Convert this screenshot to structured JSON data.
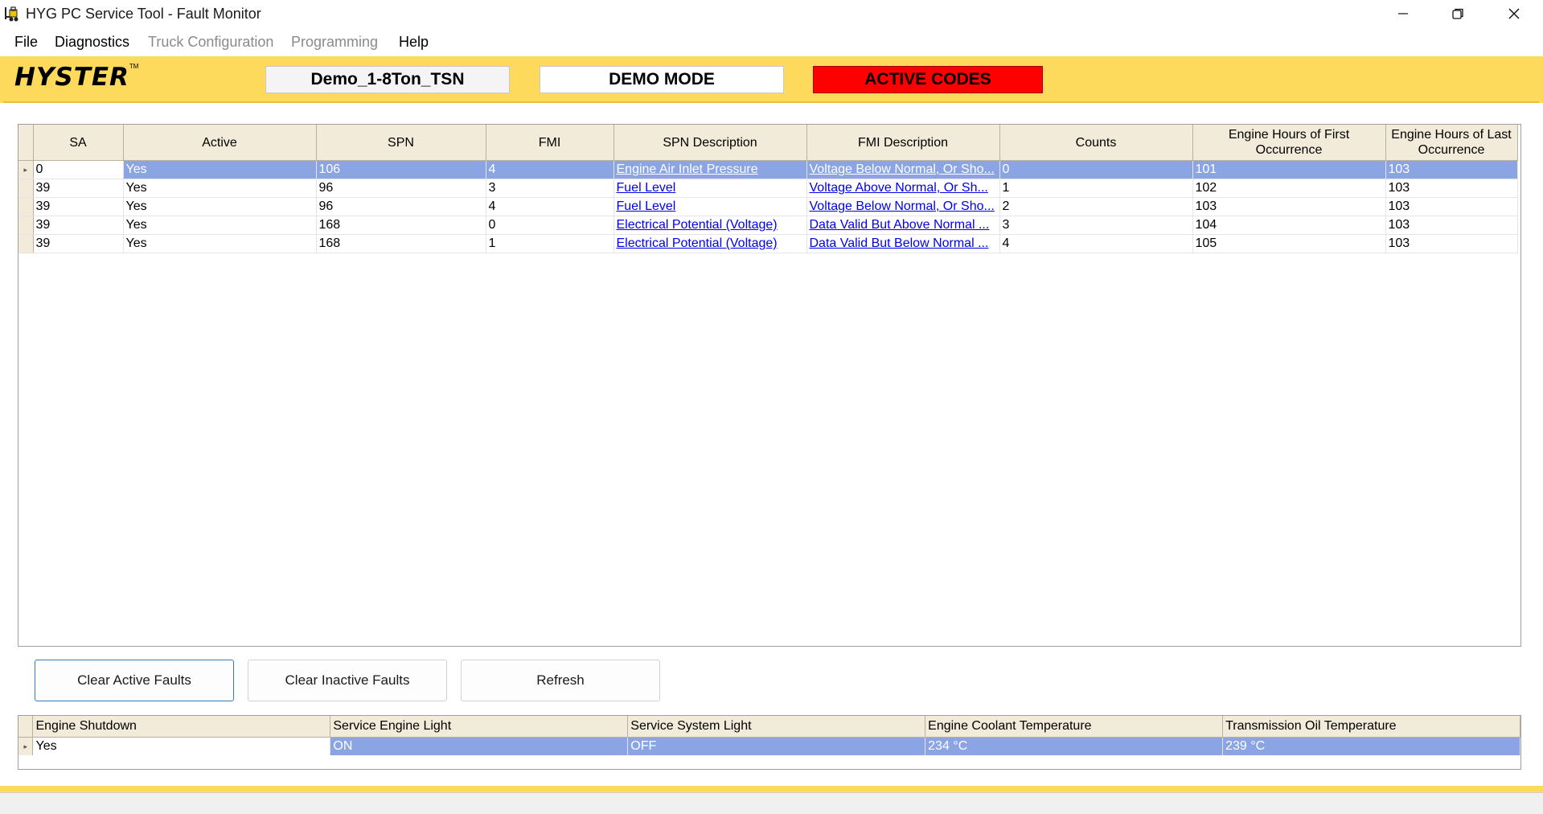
{
  "window": {
    "title": "HYG PC Service Tool - Fault Monitor",
    "minimize_icon": "minimize-icon",
    "restore_icon": "restore-icon",
    "close_icon": "close-icon"
  },
  "menu": {
    "items": [
      {
        "label": "File",
        "enabled": true
      },
      {
        "label": "Diagnostics",
        "enabled": true
      },
      {
        "label": "Truck Configuration",
        "enabled": false
      },
      {
        "label": "Programming",
        "enabled": false
      },
      {
        "label": "Help",
        "enabled": true
      }
    ]
  },
  "banner": {
    "logo_text": "HYSTER",
    "logo_tm": "TM",
    "truck_name": "Demo_1-8Ton_TSN",
    "mode": "DEMO MODE",
    "status": "ACTIVE CODES",
    "status_color": "#ff0000",
    "banner_color": "#fdda5b"
  },
  "fault_grid": {
    "columns": [
      "SA",
      "Active",
      "SPN",
      "FMI",
      "SPN Description",
      "FMI Description",
      "Counts",
      "Engine Hours of First Occurrence",
      "Engine Hours of Last Occurrence"
    ],
    "rows": [
      [
        "0",
        "Yes",
        "106",
        "4",
        "Engine Air Inlet Pressure",
        "Voltage Below Normal, Or Sho...",
        "0",
        "101",
        "103"
      ],
      [
        "39",
        "Yes",
        "96",
        "3",
        "Fuel Level",
        "Voltage Above Normal, Or Sh...",
        "1",
        "102",
        "103"
      ],
      [
        "39",
        "Yes",
        "96",
        "4",
        "Fuel Level",
        "Voltage Below Normal, Or Sho...",
        "2",
        "103",
        "103"
      ],
      [
        "39",
        "Yes",
        "168",
        "0",
        "Electrical Potential (Voltage)",
        "Data Valid But Above Normal ...",
        "3",
        "104",
        "103"
      ],
      [
        "39",
        "Yes",
        "168",
        "1",
        "Electrical Potential (Voltage)",
        "Data Valid But Below Normal ...",
        "4",
        "105",
        "103"
      ]
    ],
    "selected_row": 0,
    "selection_color": "#8aa4e4"
  },
  "buttons": {
    "clear_active": "Clear Active Faults",
    "clear_inactive": "Clear Inactive Faults",
    "refresh": "Refresh"
  },
  "status_grid": {
    "columns": [
      "Engine Shutdown",
      "Service Engine Light",
      "Service System Light",
      "Engine Coolant Temperature",
      "Transmission Oil Temperature"
    ],
    "row": [
      "Yes",
      "ON",
      "OFF",
      "234 °C",
      "239 °C"
    ]
  }
}
